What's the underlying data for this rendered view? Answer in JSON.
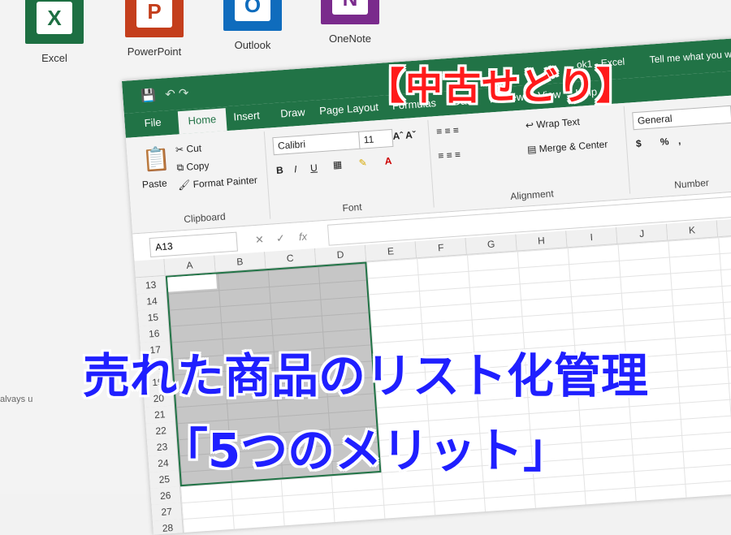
{
  "launcher": {
    "apps": [
      {
        "label": "Excel",
        "glyph": "X",
        "color": "#1d6f42"
      },
      {
        "label": "PowerPoint",
        "glyph": "P",
        "color": "#c43e1c"
      },
      {
        "label": "Outlook",
        "glyph": "O",
        "color": "#0f6cbd"
      },
      {
        "label": "OneNote",
        "glyph": "N",
        "color": "#7a2a8c"
      }
    ],
    "side_text": "alvays u"
  },
  "window": {
    "title": "ok1 - Excel",
    "tell_me": "Tell me what you want to do",
    "tabs": [
      "File",
      "Home",
      "Insert",
      "Draw",
      "Page Layout",
      "Formulas",
      "Data",
      "Review",
      "View",
      "Help"
    ]
  },
  "ribbon": {
    "clipboard": {
      "paste": "Paste",
      "cut": "Cut",
      "copy": "Copy",
      "format_painter": "Format Painter",
      "group": "Clipboard"
    },
    "font": {
      "name": "Calibri",
      "size": "11",
      "bold": "B",
      "italic": "I",
      "underline": "U",
      "group": "Font"
    },
    "alignment": {
      "wrap": "Wrap Text",
      "merge": "Merge & Center",
      "group": "Alignment"
    },
    "number": {
      "format": "General",
      "currency": "$",
      "percent": "%",
      "comma": ",",
      "group": "Number"
    }
  },
  "formula": {
    "namebox": "A13",
    "fx": "fx"
  },
  "grid": {
    "columns": [
      "A",
      "B",
      "C",
      "D",
      "E",
      "F",
      "G",
      "H",
      "I",
      "J",
      "K",
      "L"
    ],
    "rows": [
      "13",
      "14",
      "15",
      "16",
      "17",
      "18",
      "19",
      "20",
      "21",
      "22",
      "23",
      "24",
      "25",
      "26",
      "27",
      "28"
    ]
  },
  "overlay": {
    "badge": "【中古せどり】",
    "headline": "売れた商品のリスト化管理",
    "subline": "「5つのメリット」"
  },
  "colors": {
    "excel_green": "#217346",
    "badge_red": "#ff1a1a",
    "headline_blue": "#1f1fff"
  }
}
